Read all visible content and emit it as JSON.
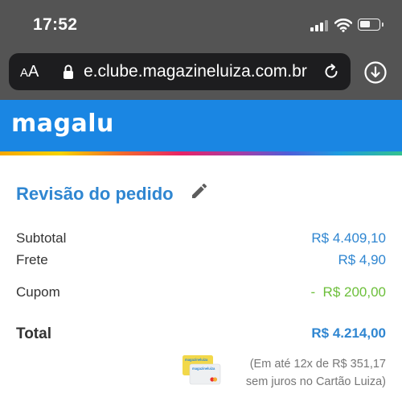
{
  "status_bar": {
    "time": "17:52",
    "battery_level": 0.55,
    "icons": [
      "signal-icon",
      "wifi-icon",
      "battery-icon"
    ]
  },
  "browser": {
    "text_size_small": "A",
    "text_size_large": "A",
    "url": "e.clube.magazineluiza.com.br",
    "icons": [
      "lock-icon",
      "reload-icon",
      "downloads-icon"
    ]
  },
  "header": {
    "logo": "magalu",
    "colors": {
      "header_bg": "#1a86e3",
      "accent": "#2f86d1",
      "discount": "#6cbf3a"
    }
  },
  "review": {
    "title": "Revisão do pedido",
    "subtotal_label": "Subtotal",
    "subtotal_value": "R$ 4.409,10",
    "shipping_label": "Frete",
    "shipping_value": "R$ 4,90",
    "coupon_label": "Cupom",
    "coupon_value": "-  R$ 200,00",
    "total_label": "Total",
    "total_value": "R$ 4.214,00",
    "installments_line1": "(Em até 12x de R$ 351,17",
    "installments_line2": "sem juros no Cartão Luiza)",
    "card_logo_text": "magazineluiza"
  }
}
